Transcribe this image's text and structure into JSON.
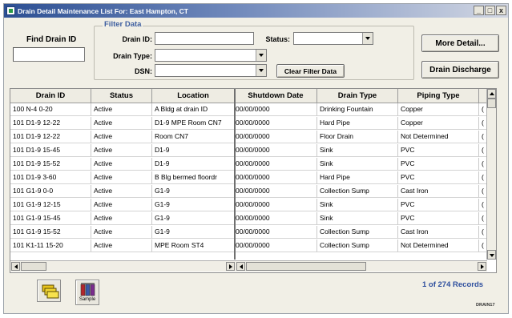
{
  "window": {
    "title": "Drain Detail Maintenance List For: East Hampton, CT",
    "controls": [
      "_",
      "□",
      "x"
    ]
  },
  "find": {
    "label": "Find Drain ID",
    "value": ""
  },
  "filter": {
    "title": "Filter Data",
    "drain_id_label": "Drain ID:",
    "drain_id_value": "",
    "status_label": "Status:",
    "status_value": "",
    "drain_type_label": "Drain Type:",
    "drain_type_value": "",
    "dsn_label": "DSN:",
    "dsn_value": "",
    "clear_label": "Clear Filter Data"
  },
  "buttons": {
    "more_detail": "More Detail...",
    "drain_discharge": "Drain Discharge"
  },
  "grid": {
    "columns": [
      "Drain ID",
      "Status",
      "Location",
      "Shutdown Date",
      "Drain Type",
      "Piping Type"
    ],
    "rows": [
      [
        "100 N-4 0-20",
        "Active",
        "A Bldg at drain ID",
        "00/00/0000",
        "Drinking Fountain",
        "Copper",
        "("
      ],
      [
        "101 D1-9 12-22",
        "Active",
        "D1-9 MPE Room CN7",
        "00/00/0000",
        "Hard Pipe",
        "Copper",
        "("
      ],
      [
        "101 D1-9 12-22",
        "Active",
        "Room CN7",
        "00/00/0000",
        "Floor Drain",
        "Not Determined",
        "("
      ],
      [
        "101 D1-9 15-45",
        "Active",
        "D1-9",
        "00/00/0000",
        "Sink",
        "PVC",
        "("
      ],
      [
        "101 D1-9 15-52",
        "Active",
        "D1-9",
        "00/00/0000",
        "Sink",
        "PVC",
        "("
      ],
      [
        "101 D1-9 3-60",
        "Active",
        "B Blg bermed floordr",
        "00/00/0000",
        "Hard Pipe",
        "PVC",
        "("
      ],
      [
        "101 G1-9 0-0",
        "Active",
        "G1-9",
        "00/00/0000",
        "Collection Sump",
        "Cast Iron",
        "("
      ],
      [
        "101 G1-9 12-15",
        "Active",
        "G1-9",
        "00/00/0000",
        "Sink",
        "PVC",
        "("
      ],
      [
        "101 G1-9 15-45",
        "Active",
        "G1-9",
        "00/00/0000",
        "Sink",
        "PVC",
        "("
      ],
      [
        "101 G1-9 15-52",
        "Active",
        "G1-9",
        "00/00/0000",
        "Collection Sump",
        "Cast Iron",
        "("
      ],
      [
        "101 K1-11 15-20",
        "Active",
        "MPE Room ST4",
        "00/00/0000",
        "Collection Sump",
        "Not Determined",
        "("
      ]
    ]
  },
  "toolbar": {
    "sample_label": "Sample"
  },
  "status": {
    "record_count": "1 of 274 Records",
    "form_code": "DRAIN17"
  }
}
